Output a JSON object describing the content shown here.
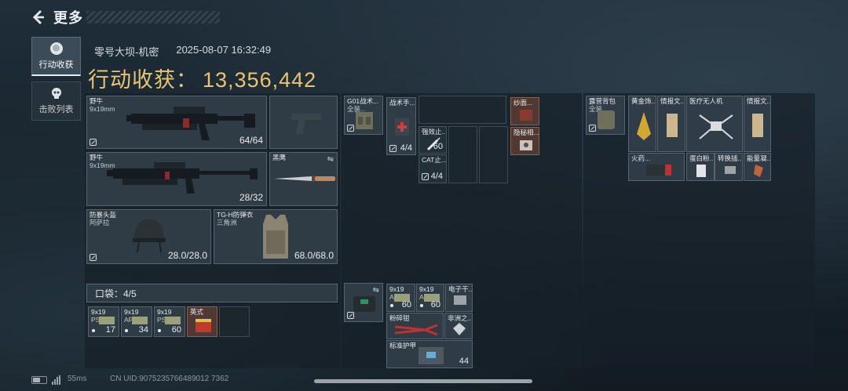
{
  "header": {
    "back_icon": "back-arrow-icon",
    "title": "更多"
  },
  "nav": {
    "active_label": "行动收获",
    "inactive_label": "击败列表"
  },
  "raid": {
    "map": "零号大坝-机密",
    "datetime": "2025-08-07 16:32:49",
    "loot_label": "行动收获：",
    "loot_value": "13,356,442"
  },
  "equipment": {
    "primary": {
      "name": "野牛",
      "caliber": "9x19mm",
      "ammo": "64/64"
    },
    "secondary": {
      "name": "野牛",
      "caliber": "9x19mm",
      "ammo": "28/32"
    },
    "knife": {
      "name": "黑鹰"
    },
    "helmet": {
      "name": "防暴头盔",
      "sub": "阿萨拉",
      "durability": "28.0/28.0"
    },
    "armor": {
      "name": "TG-H防弹衣",
      "sub": "三角洲",
      "durability": "68.0/68.0"
    }
  },
  "pocket": {
    "label": "口袋：4/5",
    "items": [
      {
        "n1": "9x19",
        "n2": "PSO",
        "count": "17"
      },
      {
        "n1": "9x19",
        "n2": "AP6.3",
        "count": "34"
      },
      {
        "n1": "9x19",
        "n2": "PSO",
        "count": "60"
      },
      {
        "n1": "英式",
        "n2": "",
        "count": ""
      }
    ]
  },
  "rig": {
    "name": "G01战术...",
    "sub": "全装...",
    "items": [
      {
        "name": "战术手...",
        "count": "4/4"
      },
      {
        "name": "强效止...",
        "count": "60"
      },
      {
        "name": "CAT止...",
        "count": "4/4"
      },
      {
        "name": "纱面...",
        "count": ""
      },
      {
        "name": "隐秘相...",
        "count": ""
      }
    ]
  },
  "backpack_items": [
    {
      "n1": "9x19",
      "n2": "AP6.3",
      "count": "60"
    },
    {
      "n1": "9x19",
      "n2": "AP6.3",
      "count": "60"
    },
    {
      "n1": "电子干...",
      "n2": "",
      "count": ""
    },
    {
      "n1": "粉碎钳",
      "n2": "",
      "count": ""
    },
    {
      "n1": "非洲之...",
      "n2": "",
      "count": ""
    },
    {
      "n1": "标准护甲",
      "n2": "",
      "count": "44"
    }
  ],
  "bag2": {
    "name": "露营背包",
    "sub": "全装...",
    "items": [
      "黄金饰...",
      "情报文...",
      "医疗无人机",
      "情报文...",
      "火药...",
      "蛋白粉...",
      "转换插...",
      "能量凝..."
    ]
  },
  "status": {
    "ping": "55ms",
    "uid": "CN UID:9075235766489012 7362"
  }
}
